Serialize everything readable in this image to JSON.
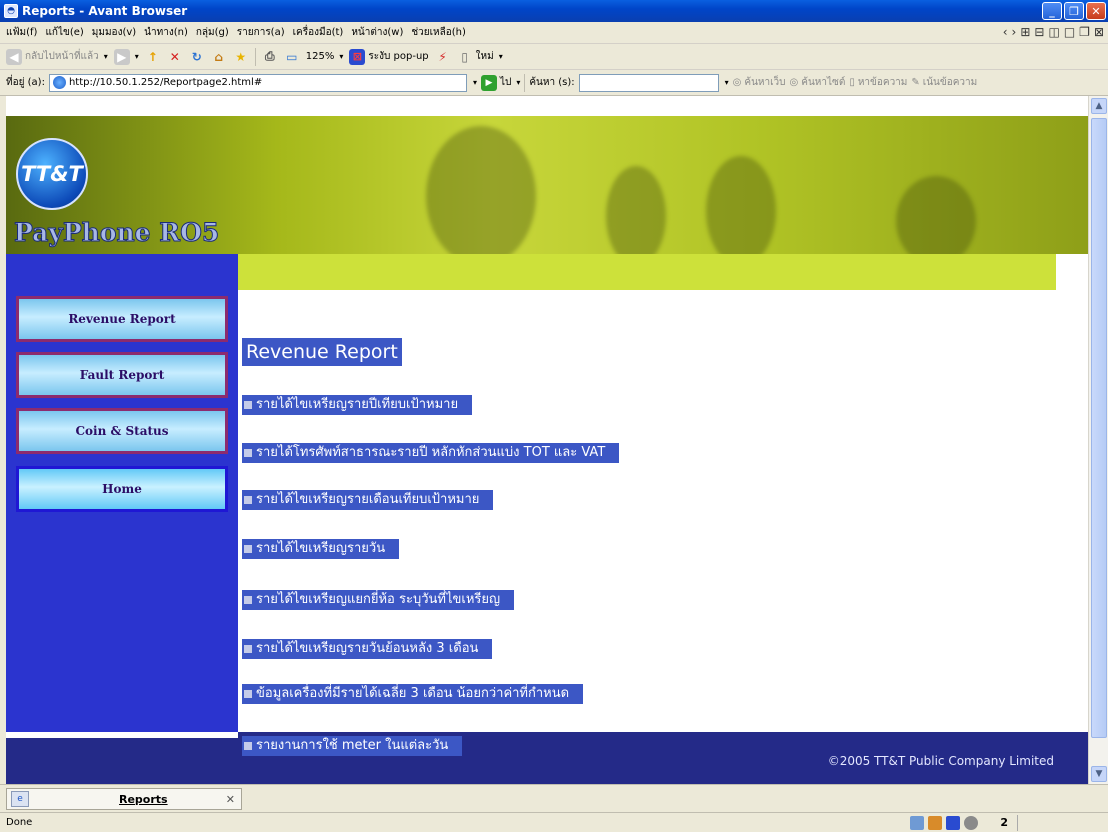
{
  "window": {
    "title": "Reports - Avant Browser",
    "icon": "browser-window-icon"
  },
  "menu": {
    "items": [
      "แฟ้ม(f)",
      "แก้ไข(e)",
      "มุมมอง(v)",
      "นำทาง(n)",
      "กลุ่ม(g)",
      "รายการ(a)",
      "เครื่องมือ(t)",
      "หน้าต่าง(w)",
      "ช่วยเหลือ(h)"
    ]
  },
  "toolbar": {
    "back_label": "กลับไปหน้าที่แล้ว",
    "zoom": "125%",
    "popup_label": "ระงับ pop-up",
    "new_label": "ใหม่"
  },
  "address": {
    "label": "ที่อยู่ (a):",
    "url": "http://10.50.1.252/Reportpage2.html#",
    "go_label": "ไป",
    "search_label": "ค้นหา (s):",
    "search_value": "",
    "search_links": [
      "ค้นหาเว็บ",
      "ค้นหาไซต์",
      "หาข้อความ",
      "เน้นข้อความ"
    ]
  },
  "page": {
    "logo_text": "TT&T",
    "brand": "PayPhone RO5",
    "sidebar": [
      "Revenue Report",
      "Fault Report",
      "Coin & Status",
      "Home"
    ],
    "heading": "Revenue Report",
    "links": [
      "รายได้ไขเหรียญรายปีเทียบเป้าหมาย",
      "รายได้โทรศัพท์สาธารณะรายปี หลักหักส่วนแบ่ง TOT และ VAT",
      "รายได้ไขเหรียญรายเดือนเทียบเป้าหมาย",
      "รายได้ไขเหรียญรายวัน",
      "รายได้ไขเหรียญแยกยี่ห้อ ระบุวันที่ไขเหรียญ",
      "รายได้ไขเหรียญรายวันย้อนหลัง 3 เดือน",
      "ข้อมูลเครื่องที่มีรายได้เฉลี่ย 3 เดือน น้อยกว่าค่าที่กำหนด",
      "รายงานการใช้ meter ในแต่ละวัน"
    ],
    "copyright": "©2005 TT&T Public Company Limited"
  },
  "tab": {
    "label": "Reports"
  },
  "status": {
    "text": "Done",
    "count": "2"
  },
  "colors": {
    "sidebar": "#2b34cf",
    "link_bg": "#3c57c5",
    "green_bar": "#cde13a",
    "footer": "#242a88"
  }
}
